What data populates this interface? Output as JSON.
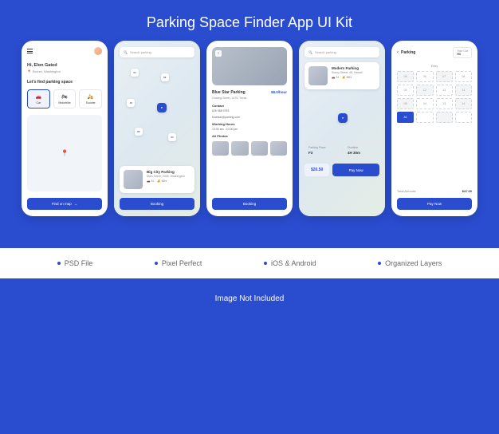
{
  "title": "Parking Space Finder App UI Kit",
  "screen1": {
    "greeting": "Hi, Elon Gated",
    "location": "Burnet, Washington",
    "find_label": "Let's find parking space",
    "tabs": [
      {
        "label": "Car",
        "icon": "🚗"
      },
      {
        "label": "Motorbike",
        "icon": "🏍"
      },
      {
        "label": "Scooter",
        "icon": "🛵"
      }
    ],
    "cta": "Find on map"
  },
  "screen2": {
    "search_placeholder": "Search parking",
    "markers": [
      "01",
      "03",
      "10",
      "05",
      "01",
      "15"
    ],
    "card": {
      "name": "Big City Parking",
      "address": "Main Street, 2345, Washington",
      "meta1": "34",
      "meta2": "$8hr"
    },
    "cta": "Booking"
  },
  "screen3": {
    "name": "Blue Star Parking",
    "address": "Grazing Street, 1475, Texas",
    "price": "$8.0/hour",
    "contact_label": "Contact",
    "phone": "626 988 9753",
    "email": "bluestar@parking.com",
    "hours_label": "Working Hours",
    "hours": "10.00 am - 10.00 pm",
    "photos_label": "All Photos",
    "cta": "Booking"
  },
  "screen4": {
    "search_placeholder": "Search parking",
    "card": {
      "name": "Modern Parking",
      "address": "Sunny Street, 48, Hawaii",
      "meta1": "34",
      "meta2": "$8hr"
    },
    "place_label": "Parking Place",
    "place_value": "F3",
    "duration_label": "Duration",
    "duration_value": "4H 30m",
    "price": "$20.50",
    "cta": "Pay Now"
  },
  "screen5": {
    "title": "Parking",
    "car_label": "Your Car",
    "car_value": "H3",
    "entry_label": "Entry",
    "spots": [
      [
        "05",
        "06",
        "07",
        "08"
      ],
      [
        "05",
        "12",
        "13",
        "14"
      ],
      [
        "05",
        "04",
        "13",
        "14"
      ],
      [
        "A1",
        "",
        "",
        ""
      ]
    ],
    "total_label": "Total Amount:",
    "total_value": "$47.00",
    "cta": "Pay Now"
  },
  "features": [
    "PSD File",
    "Pixel Perfect",
    "iOS & Android",
    "Organized Layers"
  ],
  "footnote": "Image Not Included"
}
